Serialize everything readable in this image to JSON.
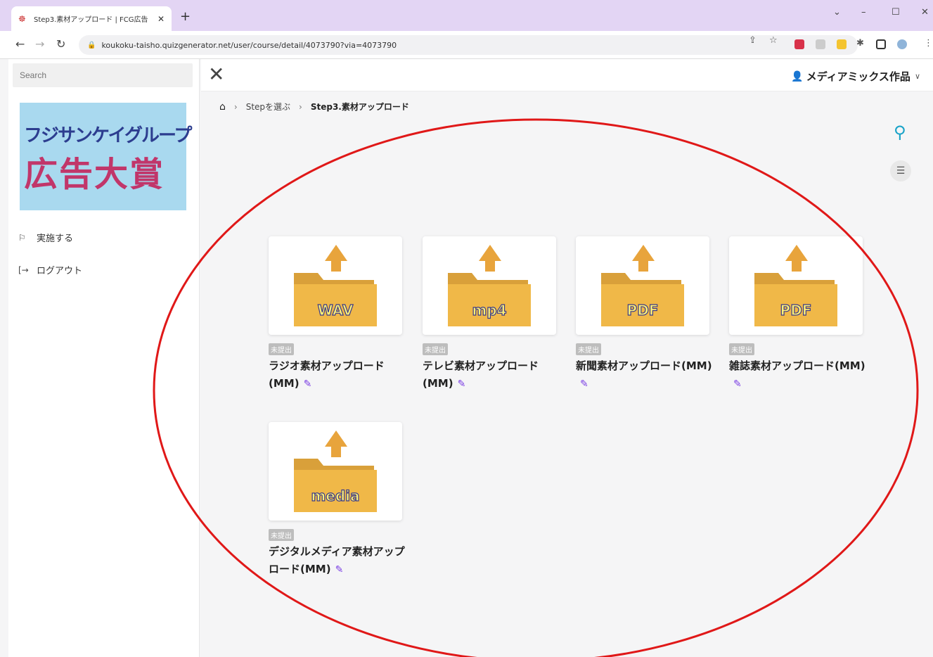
{
  "browser": {
    "tab_title": "Step3.素材アップロード | FCG広告",
    "tab_close": "✕",
    "new_tab": "+",
    "url": "koukoku-taisho.quizgenerator.net/user/course/detail/4073790?via=4073790",
    "window_controls": [
      "⌄",
      "–",
      "☐",
      "✕"
    ]
  },
  "sidebar": {
    "search_placeholder": "Search",
    "logo_line1": "フジサンケイグループ",
    "logo_line2": "広告大賞",
    "logo_colors": {
      "background": "#a9d9ef",
      "line1": "#2c3d8f",
      "line2": "#c1366a"
    },
    "items": [
      {
        "label": "実施する",
        "icon": "flag-icon"
      },
      {
        "label": "ログアウト",
        "icon": "logout-icon"
      }
    ]
  },
  "header": {
    "user_name": "メディアミックス作品"
  },
  "breadcrumb": {
    "step1": "Stepを選ぶ",
    "step2": "Step3.素材アップロード"
  },
  "cards": [
    {
      "badge": "未提出",
      "title": "ラジオ素材アップロード(MM)",
      "file_label": "WAV"
    },
    {
      "badge": "未提出",
      "title": "テレビ素材アップロード(MM)",
      "file_label": "mp4"
    },
    {
      "badge": "未提出",
      "title": "新聞素材アップロード(MM)",
      "file_label": "PDF"
    },
    {
      "badge": "未提出",
      "title": "雑誌素材アップロード(MM)",
      "file_label": "PDF"
    },
    {
      "badge": "未提出",
      "title": "デジタルメディア素材アップロード(MM)",
      "file_label": "media"
    }
  ],
  "colors": {
    "folder": "#f0b848",
    "arrow": "#e8a43c",
    "accent": "#19a3c8",
    "edit": "#7b3fe4",
    "annotation": "#e01818"
  }
}
